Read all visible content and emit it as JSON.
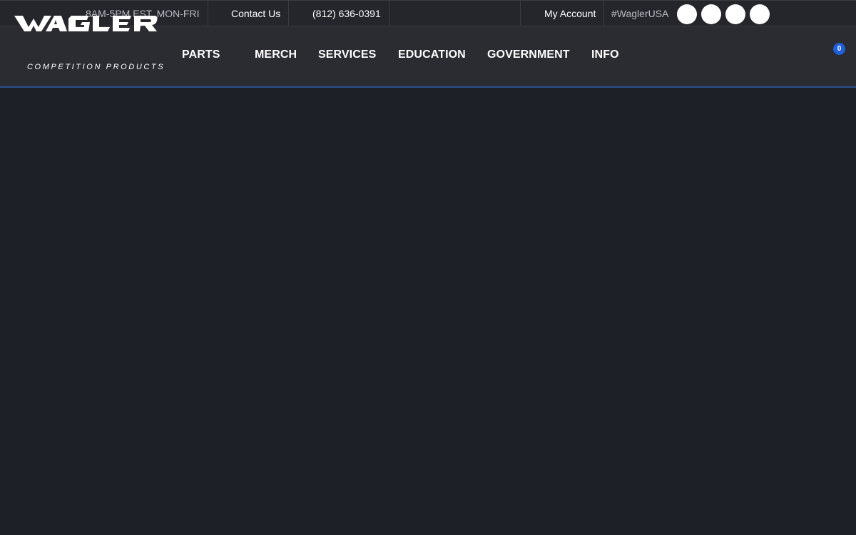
{
  "topbar": {
    "hours": "8AM-5PM EST, MON-FRI",
    "contact_label": "Contact Us",
    "phone": "(812) 636-0391",
    "account_label": "My Account",
    "hashtag": "#WaglerUSA",
    "social_icons": [
      "social-icon-1",
      "social-icon-2",
      "social-icon-3",
      "social-icon-4"
    ]
  },
  "header": {
    "logo_text": "WAGLER",
    "logo_subtitle": "COMPETITION PRODUCTS",
    "nav": {
      "parts": "PARTS",
      "merch": "MERCH",
      "services": "SERVICES",
      "education": "EDUCATION",
      "government": "GOVERNMENT",
      "info": "INFO"
    },
    "cart_count": "0"
  },
  "colors": {
    "background": "#1e2028",
    "topbar": "#24262c",
    "navbar": "#2a2c31",
    "accent_blue": "#1f5fd8"
  }
}
